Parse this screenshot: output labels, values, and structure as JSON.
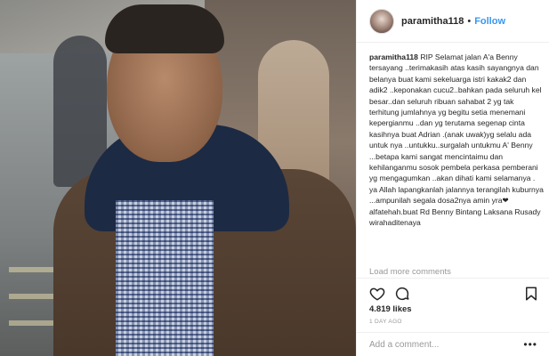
{
  "post": {
    "username": "paramitha118",
    "follow_label": "Follow",
    "separator": "•",
    "caption_user": "paramitha118",
    "caption_lines": [
      "RIP Selamat jalan A'a Benny",
      "tersayang ..terimakasih atas kasih",
      "sayangnya dan belanya buat kami",
      "sekeluarga istri kakak2 dan adik2",
      "..keponakan cucu2..bahkan pada seluruh",
      "kel besar..dan seluruh ribuan sahabat 2 yg",
      "tak terhitung jumlahnya yg begitu setia",
      "menemani kepergianmu ..dan yg terutama",
      "segenap cinta kasihnya buat Adrian .(anak",
      "uwak)yg selalu ada untuk nya",
      "..untukku..surgalah untukmu A' Benny",
      "...betapa kami sangat mencintaimu dan",
      "kehilanganmu sosok pembela perkasa",
      "pemberani yg mengagumkan ..akan dihati",
      "kami selamanya . ya Allah lapangkanlah",
      "jalannya terangilah kuburnya ...ampunilah",
      "segala dosa2nya amin yra❤alfatehah.buat",
      "Rd Benny Bintang Laksana Rusady",
      "wirahaditenaya"
    ],
    "load_more": "Load more comments",
    "likes": "4.819 likes",
    "time_ago": "1 DAY AGO",
    "comment_placeholder": "Add a comment...",
    "more_label": "•••",
    "accent_color": "#3897f0"
  }
}
